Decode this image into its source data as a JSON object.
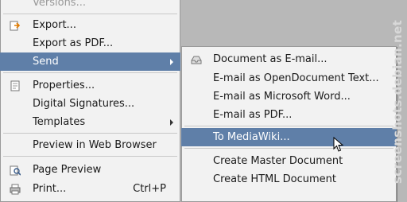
{
  "file_menu": {
    "items": [
      {
        "label": "Versions...",
        "muted": true
      },
      {
        "label": "Export..."
      },
      {
        "label": "Export as PDF..."
      },
      {
        "label": "Send",
        "submenu": true,
        "highlighted": true
      },
      {
        "label": "Properties..."
      },
      {
        "label": "Digital Signatures..."
      },
      {
        "label": "Templates",
        "submenu": true
      },
      {
        "label": "Preview in Web Browser"
      },
      {
        "label": "Page Preview"
      },
      {
        "label": "Print...",
        "shortcut": "Ctrl+P"
      }
    ]
  },
  "send_menu": {
    "items": [
      {
        "label": "Document as E-mail..."
      },
      {
        "label": "E-mail as OpenDocument Text..."
      },
      {
        "label": "E-mail as Microsoft Word..."
      },
      {
        "label": "E-mail as PDF..."
      },
      {
        "label": "To MediaWiki...",
        "highlighted": true
      },
      {
        "label": "Create Master Document"
      },
      {
        "label": "Create HTML Document"
      }
    ]
  },
  "watermark": "screenshots.debian.net",
  "colors": {
    "highlight": "#5f7fa8",
    "menu_bg": "#f2f2f2",
    "desktop": "#b8b8b8"
  }
}
